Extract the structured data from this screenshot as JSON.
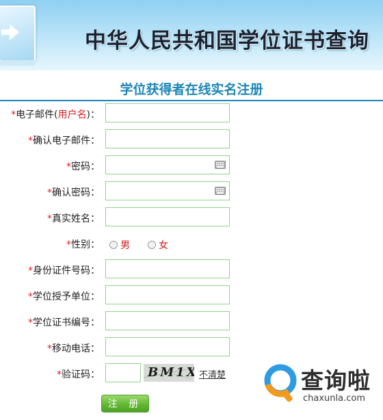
{
  "banner": {
    "title": "中华人民共和国学位证书查询"
  },
  "form": {
    "heading": "学位获得者在线实名注册",
    "required_mark": "*",
    "colon": "：",
    "fields": {
      "email": {
        "prefix": "电子邮件(",
        "highlight": "用户名",
        "suffix": ")"
      },
      "email_confirm": "确认电子邮件",
      "password": "密码",
      "password_confirm": "确认密码",
      "real_name": "真实姓名",
      "gender": "性别",
      "id_number": "身份证件号码",
      "degree_institution": "学位授予单位",
      "certificate_number": "学位证书编号",
      "mobile": "移动电话",
      "captcha": "验证码"
    },
    "gender_options": [
      "男",
      "女"
    ],
    "captcha_text": "BM1X",
    "captcha_refresh": "不清楚",
    "submit_label": "注 册"
  },
  "watermark": {
    "logo_text": "查询啦",
    "site": "chaxunla.com"
  }
}
